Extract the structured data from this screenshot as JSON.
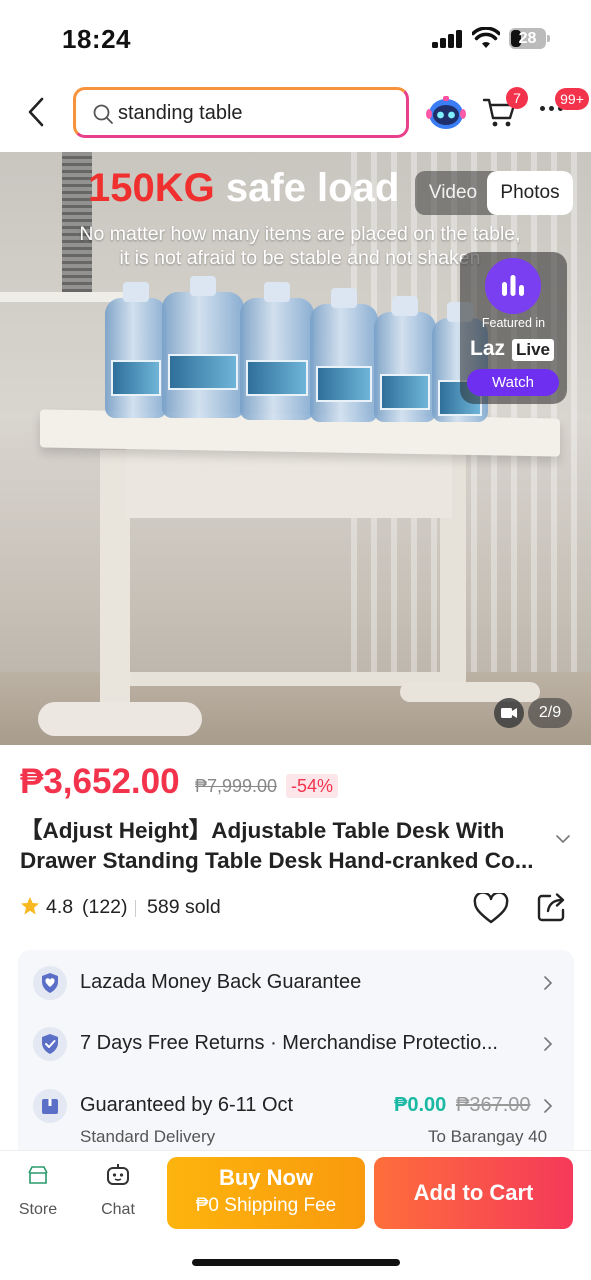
{
  "status_bar": {
    "time": "18:24",
    "battery": "28"
  },
  "header": {
    "search_text": "standing table",
    "cart_badge": "7",
    "more_badge": "99+"
  },
  "hero": {
    "headline_red": "150KG",
    "headline_white": "safe load",
    "subline_1": "No matter how many items are placed on the table,",
    "subline_2": "it is not afraid to be stable and not shaken",
    "toggle_video": "Video",
    "toggle_photos": "Photos",
    "live_featured": "Featured in",
    "live_brand_1": "Laz",
    "live_brand_2": "Live",
    "live_watch": "Watch",
    "page_counter": "2/9"
  },
  "product": {
    "price": "₱3,652.00",
    "old_price": "₱7,999.00",
    "discount": "-54%",
    "title_line_1": "【Adjust Height】Adjustable  Table Desk With",
    "title_line_2": "Drawer Standing Table Desk Hand-cranked Co...",
    "rating": "4.8",
    "review_count": "(122)",
    "sold": "589 sold"
  },
  "info": {
    "row1": "Lazada Money Back Guarantee",
    "row2": "7 Days Free Returns · Merchandise Protectio...",
    "row3": "Guaranteed by 6-11 Oct",
    "row3_price": "₱0.00",
    "row3_old": "₱367.00",
    "row3_sub": "Standard Delivery",
    "row3_to": "To Barangay 40"
  },
  "bottom": {
    "store": "Store",
    "chat": "Chat",
    "buy_now": "Buy Now",
    "shipping": "₱0 Shipping Fee",
    "add_to_cart": "Add to Cart"
  },
  "colors": {
    "accent_red": "#f3334c",
    "buy_orange": "#fdb40d",
    "cart_red": "#f5395a",
    "teal": "#1bb9a4"
  }
}
